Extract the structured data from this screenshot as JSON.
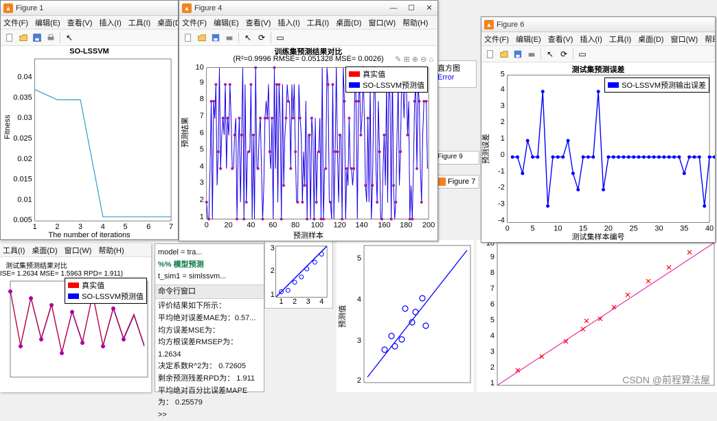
{
  "watermark": "CSDN @前程算法屋",
  "menus": {
    "file": "文件(F)",
    "edit": "编辑(E)",
    "view": "查看(V)",
    "insert": "插入(I)",
    "tool": "工具(I)",
    "desk": "桌面(D)",
    "win": "窗口(W)",
    "help": "帮助(H)"
  },
  "winctrl": {
    "min": "—",
    "max": "☐",
    "close": "✕"
  },
  "fig1": {
    "title": "Figure 1",
    "plot_title": "SO-LSSVM",
    "xlabel": "The number of iterations",
    "ylabel": "Fitness",
    "yticks": [
      "0.005",
      "0.01",
      "0.015",
      "0.02",
      "0.025",
      "0.03",
      "0.035",
      "0.04"
    ],
    "xticks": [
      "1",
      "2",
      "3",
      "4",
      "5",
      "6",
      "7"
    ],
    "chart_data": {
      "type": "line",
      "x": [
        1,
        2,
        3,
        4,
        5,
        6,
        7
      ],
      "y": [
        0.037,
        0.035,
        0.035,
        0.006,
        0.006,
        0.006,
        0.006
      ],
      "xlim": [
        1,
        7
      ],
      "ylim": [
        0.005,
        0.04
      ]
    }
  },
  "fig4": {
    "title": "Figure 4",
    "plot_title": "训练集预测结果对比",
    "subtitle": "(R²=0.9996 RMSE= 0.051328 MSE= 0.0026)",
    "xlabel": "预测样本",
    "ylabel": "预测结果",
    "legend": [
      "真实值",
      "SO-LSSVM预测值"
    ],
    "yticks": [
      "1",
      "2",
      "3",
      "4",
      "5",
      "6",
      "7",
      "8",
      "9",
      "10"
    ],
    "xticks": [
      "0",
      "20",
      "40",
      "60",
      "80",
      "100",
      "120",
      "140",
      "160",
      "180",
      "200"
    ]
  },
  "fig6": {
    "title": "Figure 6",
    "plot_title": "测试集预测误差",
    "xlabel": "测试集样本编号",
    "ylabel": "预测误差",
    "legend": [
      "SO-LSSVM预测输出误差"
    ],
    "yticks": [
      "-4",
      "-3",
      "-2",
      "-1",
      "0",
      "1",
      "2",
      "3",
      "4",
      "5"
    ],
    "xticks": [
      "0",
      "5",
      "10",
      "15",
      "20",
      "25",
      "30",
      "35",
      "40"
    ],
    "chart_data": {
      "type": "line",
      "x": [
        1,
        2,
        3,
        4,
        5,
        6,
        7,
        8,
        9,
        10,
        11,
        12,
        13,
        14,
        15,
        16,
        17,
        18,
        19,
        20,
        21,
        22,
        23,
        24,
        25,
        26,
        27,
        28,
        29,
        30,
        31,
        32,
        33,
        34,
        35,
        36,
        37,
        38,
        39,
        40,
        41
      ],
      "y": [
        0,
        0,
        -1,
        1,
        0,
        0,
        4,
        -3,
        0,
        0,
        0,
        1,
        -1,
        -2,
        0,
        0,
        0,
        4,
        -2,
        0,
        0,
        0,
        0,
        0,
        0,
        0,
        0,
        0,
        0,
        0,
        0,
        0,
        0,
        0,
        -1,
        0,
        0,
        0,
        -3,
        0,
        0
      ],
      "ylim": [
        -4,
        5
      ]
    }
  },
  "frag_menus": {
    "tool": "工具(I)",
    "desk": "桌面(D)",
    "win": "窗口(W)",
    "help": "帮助(H)"
  },
  "frag_chart": {
    "title": "测试集预测结果对比",
    "subtitle": "ISE= 1.2634 MSE= 1.5963 RPD= 1.911)",
    "legend": [
      "真实值",
      "SO-LSSVM预测值"
    ]
  },
  "code": {
    "line1": "model = tra...",
    "hdr": "%% 模型预测",
    "line2": "t_sim1 = simlssvm...",
    "panel": "命令行窗口",
    "l1": "评价结果如下所示：",
    "l2": "平均绝对误差MAE为：0.57...",
    "l3": "均方误差MSE为：",
    "l4": "均方根误差RMSEP为：    1.2634",
    "l5": "决定系数R^2为：    0.72605",
    "l6": "剩余预测残差RPD为：    1.911",
    "l7": "平均绝对百分比误差MAPE为：    0.25579",
    "prompt": ">>"
  },
  "small_chart": {
    "xticks": [
      "1",
      "2",
      "3",
      "4"
    ],
    "yticks": [
      "1",
      "2",
      "3"
    ]
  },
  "scatter_blue": {
    "ylabel": "预测值",
    "yticks": [
      "2",
      "3",
      "4",
      "5"
    ]
  },
  "scatter_red": {
    "yticks": [
      "1",
      "2",
      "3",
      "4",
      "5",
      "6",
      "7",
      "8",
      "9",
      "10"
    ]
  },
  "bg_frags": {
    "figure7": "Figure 7",
    "figure9": "Figure 9",
    "hist": "直方图",
    "error": "Error"
  }
}
